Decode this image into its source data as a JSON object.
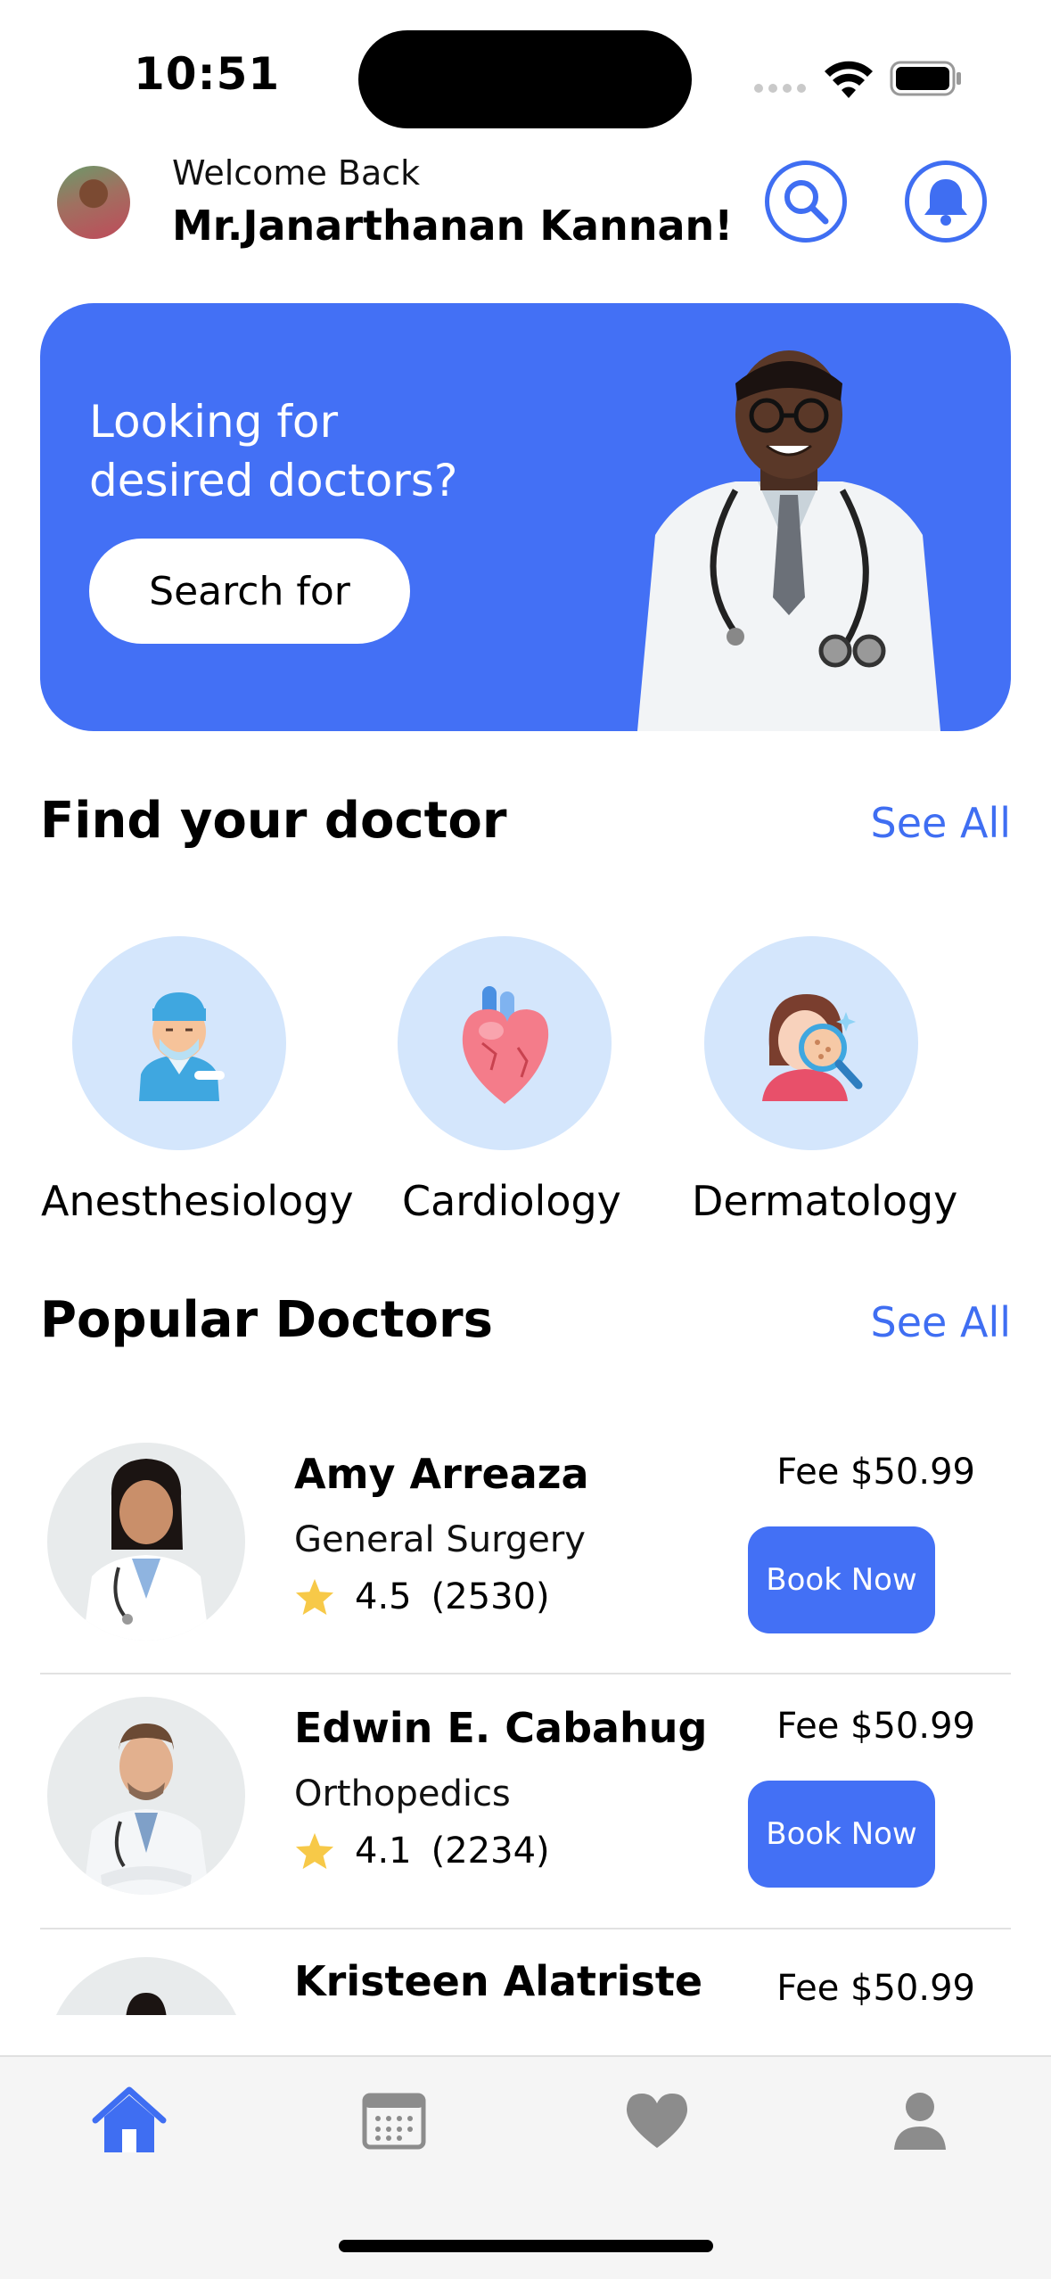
{
  "status_bar": {
    "time": "10:51"
  },
  "header": {
    "welcome": "Welcome Back",
    "user_name": "Mr.Janarthanan Kannan!",
    "search_icon": "search-icon",
    "bell_icon": "bell-icon"
  },
  "banner": {
    "title": "Looking for desired doctors?",
    "button_label": "Search for"
  },
  "find_doctor": {
    "title": "Find your doctor",
    "see_all": "See All",
    "specialties": [
      {
        "label": "Anesthesiology",
        "icon": "anesthesiologist-icon"
      },
      {
        "label": "Cardiology",
        "icon": "heart-icon"
      },
      {
        "label": "Dermatology",
        "icon": "dermatology-icon"
      }
    ]
  },
  "popular": {
    "title": "Popular Doctors",
    "see_all": "See All",
    "doctors": [
      {
        "name": "Amy Arreaza",
        "specialty": "General Surgery",
        "rating": "4.5",
        "reviews": "(2530)",
        "fee": "Fee $50.99",
        "button": "Book Now"
      },
      {
        "name": "Edwin E. Cabahug",
        "specialty": "Orthopedics",
        "rating": "4.1",
        "reviews": "(2234)",
        "fee": "Fee $50.99",
        "button": "Book Now"
      },
      {
        "name": "Kristeen Alatriste",
        "fee": "Fee $50.99"
      }
    ]
  },
  "tab_bar": {
    "tabs": [
      "home-icon",
      "calendar-icon",
      "heart-icon",
      "profile-icon"
    ],
    "active": "home-icon"
  },
  "colors": {
    "accent": "#4370F5",
    "accent_outline": "#3F6EF2",
    "specialty_bg": "#D4E6FC",
    "star": "#F7C948"
  }
}
